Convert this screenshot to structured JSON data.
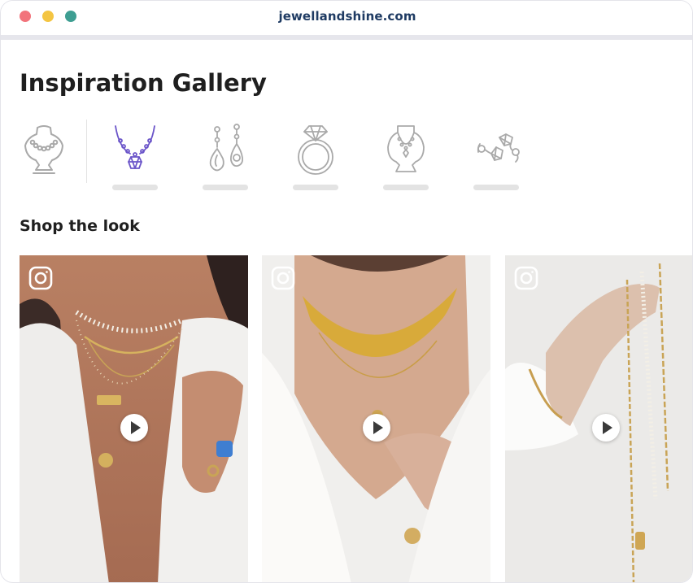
{
  "browser": {
    "url": "jewellandshine.com"
  },
  "gallery": {
    "title": "Inspiration Gallery"
  },
  "categories": [
    {
      "icon": "bust-necklace-icon",
      "selected": false
    },
    {
      "icon": "necklace-pendant-icon",
      "selected": true
    },
    {
      "icon": "drop-earrings-icon",
      "selected": false
    },
    {
      "icon": "diamond-ring-icon",
      "selected": false
    },
    {
      "icon": "bust-chain-necklace-icon",
      "selected": false
    },
    {
      "icon": "diamond-earrings-icon",
      "selected": false
    }
  ],
  "shop_the_look": {
    "title": "Shop the look",
    "cards": [
      {
        "source_icon": "instagram-icon",
        "media": "video"
      },
      {
        "source_icon": "instagram-icon",
        "media": "video"
      },
      {
        "source_icon": "instagram-icon",
        "media": "video"
      }
    ]
  },
  "colors": {
    "accent": "#6b55c9",
    "icon_gray": "#a9a9a9",
    "url_text": "#1f3b63"
  }
}
